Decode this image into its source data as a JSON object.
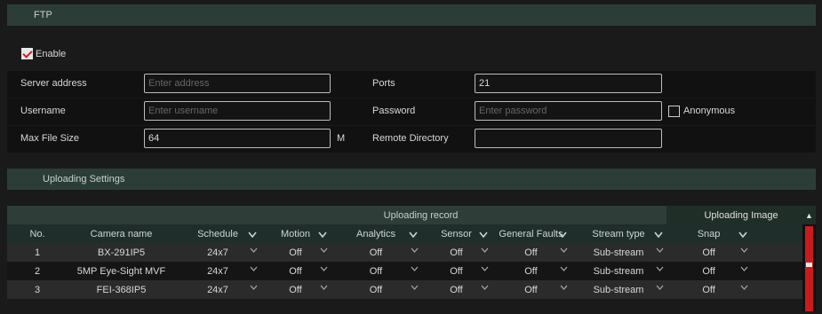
{
  "ftp": {
    "section_title": "FTP",
    "enable_label": "Enable",
    "enable_checked": true,
    "server_address_label": "Server address",
    "server_address_placeholder": "Enter address",
    "server_address_value": "",
    "ports_label": "Ports",
    "ports_value": "21",
    "username_label": "Username",
    "username_placeholder": "Enter username",
    "username_value": "",
    "password_label": "Password",
    "password_placeholder": "Enter password",
    "password_value": "",
    "anonymous_label": "Anonymous",
    "anonymous_checked": false,
    "max_file_size_label": "Max File Size",
    "max_file_size_value": "64",
    "max_file_size_unit": "M",
    "remote_directory_label": "Remote Directory",
    "remote_directory_value": ""
  },
  "uploading": {
    "section_title": "Uploading Settings",
    "group_record": "Uploading record",
    "group_image": "Uploading Image",
    "columns": [
      "No.",
      "Camera name",
      "Schedule",
      "Motion",
      "Analytics",
      "Sensor",
      "General Faults",
      "Stream type",
      "Snap"
    ],
    "rows": [
      [
        "1",
        "BX-291IP5",
        "24x7",
        "Off",
        "Off",
        "Off",
        "Off",
        "Sub-stream",
        "Off"
      ],
      [
        "2",
        "5MP Eye-Sight MVF",
        "24x7",
        "Off",
        "Off",
        "Off",
        "Off",
        "Sub-stream",
        "Off"
      ],
      [
        "3",
        "FEI-368IP5",
        "24x7",
        "Off",
        "Off",
        "Off",
        "Off",
        "Sub-stream",
        "Off"
      ]
    ]
  },
  "colors": {
    "accent_red": "#d21f1f",
    "section_bar": "#2c3d38",
    "row_odd": "#2b2b2b",
    "row_even": "#151515"
  }
}
